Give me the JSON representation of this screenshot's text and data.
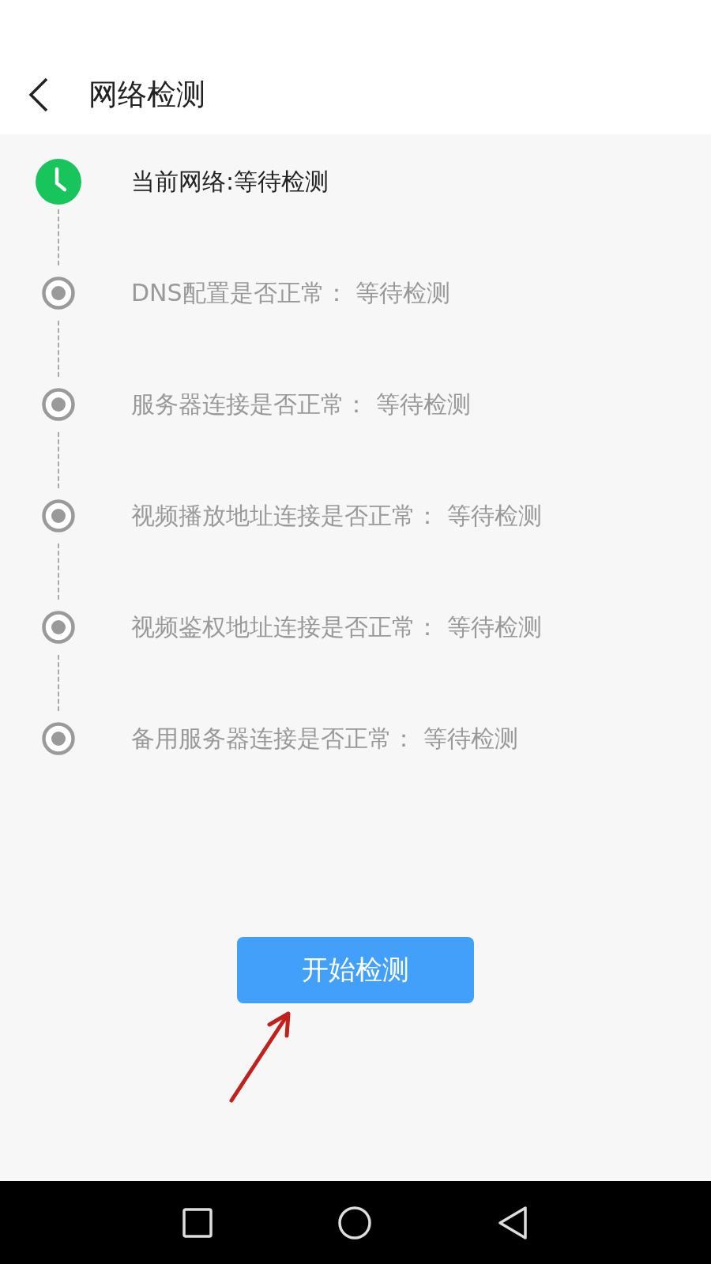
{
  "header": {
    "title": "网络检测"
  },
  "steps": [
    {
      "kind": "current",
      "label": "当前网络:等待检测"
    },
    {
      "kind": "pending",
      "label": "DNS配置是否正常： 等待检测"
    },
    {
      "kind": "pending",
      "label": "服务器连接是否正常： 等待检测"
    },
    {
      "kind": "pending",
      "label": "视频播放地址连接是否正常： 等待检测"
    },
    {
      "kind": "pending",
      "label": "视频鉴权地址连接是否正常： 等待检测"
    },
    {
      "kind": "pending",
      "label": "备用服务器连接是否正常： 等待检测"
    }
  ],
  "start_button": {
    "label": "开始检测"
  }
}
